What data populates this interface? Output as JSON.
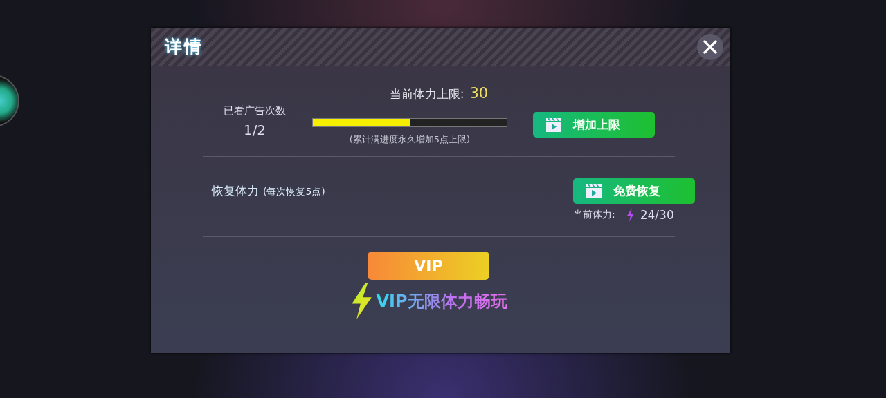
{
  "dialog": {
    "title": "详情"
  },
  "limit": {
    "label": "当前体力上限:",
    "value": "30"
  },
  "ad_progress": {
    "label": "已看广告次数",
    "count": "1/2",
    "level": 0.5,
    "note": "(累计满进度永久增加5点上限)",
    "button": "增加上限"
  },
  "recover": {
    "label": "恢复体力",
    "note": "(每次恢复5点)",
    "button": "免费恢复",
    "current_label": "当前体力:",
    "current_value": "24/30"
  },
  "vip": {
    "button": "VIP",
    "slogan": "VIP无限体力畅玩"
  }
}
